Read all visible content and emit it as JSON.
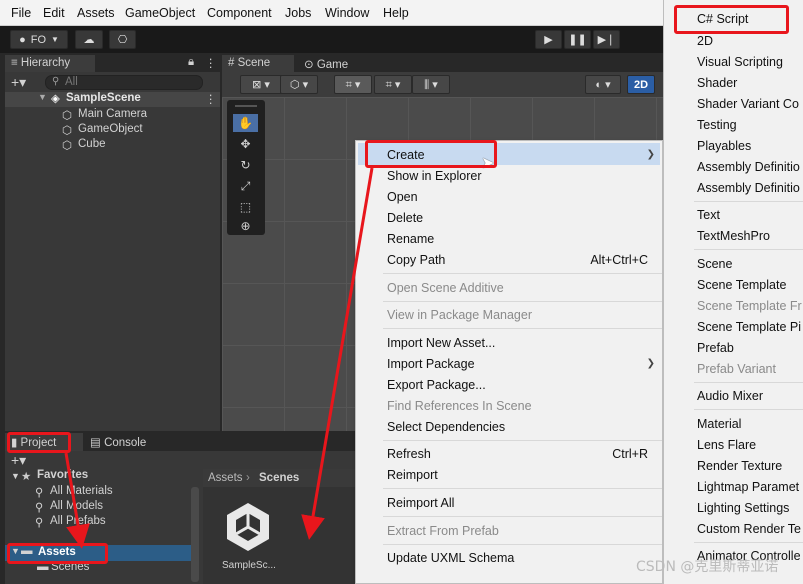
{
  "menubar": [
    "File",
    "Edit",
    "Assets",
    "GameObject",
    "Component",
    "Jobs",
    "Window",
    "Help"
  ],
  "toolbar": {
    "account": "FO",
    "mode_2d": "2D"
  },
  "hierarchy": {
    "tab": "Hierarchy",
    "search_placeholder": "All",
    "scene": "SampleScene",
    "objects": [
      "Main Camera",
      "GameObject",
      "Cube"
    ]
  },
  "scene_tabs": [
    "Scene",
    "Game"
  ],
  "project": {
    "tabs": [
      "Project",
      "Console"
    ],
    "favorites_label": "Favorites",
    "favorites": [
      "All Materials",
      "All Models",
      "All Prefabs"
    ],
    "assets_label": "Assets",
    "assets_children": [
      "Scenes"
    ],
    "breadcrumb": [
      "Assets",
      "Scenes"
    ],
    "asset_name": "SampleSc..."
  },
  "context_menu": [
    {
      "label": "Create",
      "submenu": true,
      "highlighted": true
    },
    {
      "label": "Show in Explorer"
    },
    {
      "label": "Open"
    },
    {
      "label": "Delete"
    },
    {
      "label": "Rename"
    },
    {
      "label": "Copy Path",
      "shortcut": "Alt+Ctrl+C"
    },
    {
      "label": "Open Scene Additive",
      "disabled": true
    },
    {
      "label": "View in Package Manager",
      "disabled": true
    },
    {
      "label": "Import New Asset..."
    },
    {
      "label": "Import Package",
      "submenu": true
    },
    {
      "label": "Export Package..."
    },
    {
      "label": "Find References In Scene",
      "disabled": true
    },
    {
      "label": "Select Dependencies"
    },
    {
      "label": "Refresh",
      "shortcut": "Ctrl+R"
    },
    {
      "label": "Reimport"
    },
    {
      "label": "Reimport All"
    },
    {
      "label": "Extract From Prefab",
      "disabled": true
    },
    {
      "label": "Update UXML Schema"
    }
  ],
  "create_submenu": [
    {
      "label": "C# Script"
    },
    {
      "label": "2D"
    },
    {
      "label": "Visual Scripting"
    },
    {
      "label": "Shader"
    },
    {
      "label": "Shader Variant Co"
    },
    {
      "label": "Testing"
    },
    {
      "label": "Playables"
    },
    {
      "label": "Assembly Definitio"
    },
    {
      "label": "Assembly Definitio"
    },
    {
      "label": "Text"
    },
    {
      "label": "TextMeshPro"
    },
    {
      "label": "Scene"
    },
    {
      "label": "Scene Template"
    },
    {
      "label": "Scene Template Fr",
      "disabled": true
    },
    {
      "label": "Scene Template Pi"
    },
    {
      "label": "Prefab"
    },
    {
      "label": "Prefab Variant",
      "disabled": true
    },
    {
      "label": "Audio Mixer"
    },
    {
      "label": "Material"
    },
    {
      "label": "Lens Flare"
    },
    {
      "label": "Render Texture"
    },
    {
      "label": "Lightmap Paramet"
    },
    {
      "label": "Lighting Settings"
    },
    {
      "label": "Custom Render Te"
    },
    {
      "label": "Animator Controlle"
    }
  ],
  "watermark": "CSDN @克里斯蒂亚诺",
  "colors": {
    "annotation": "#e8161c",
    "highlight": "#c8daf0"
  }
}
